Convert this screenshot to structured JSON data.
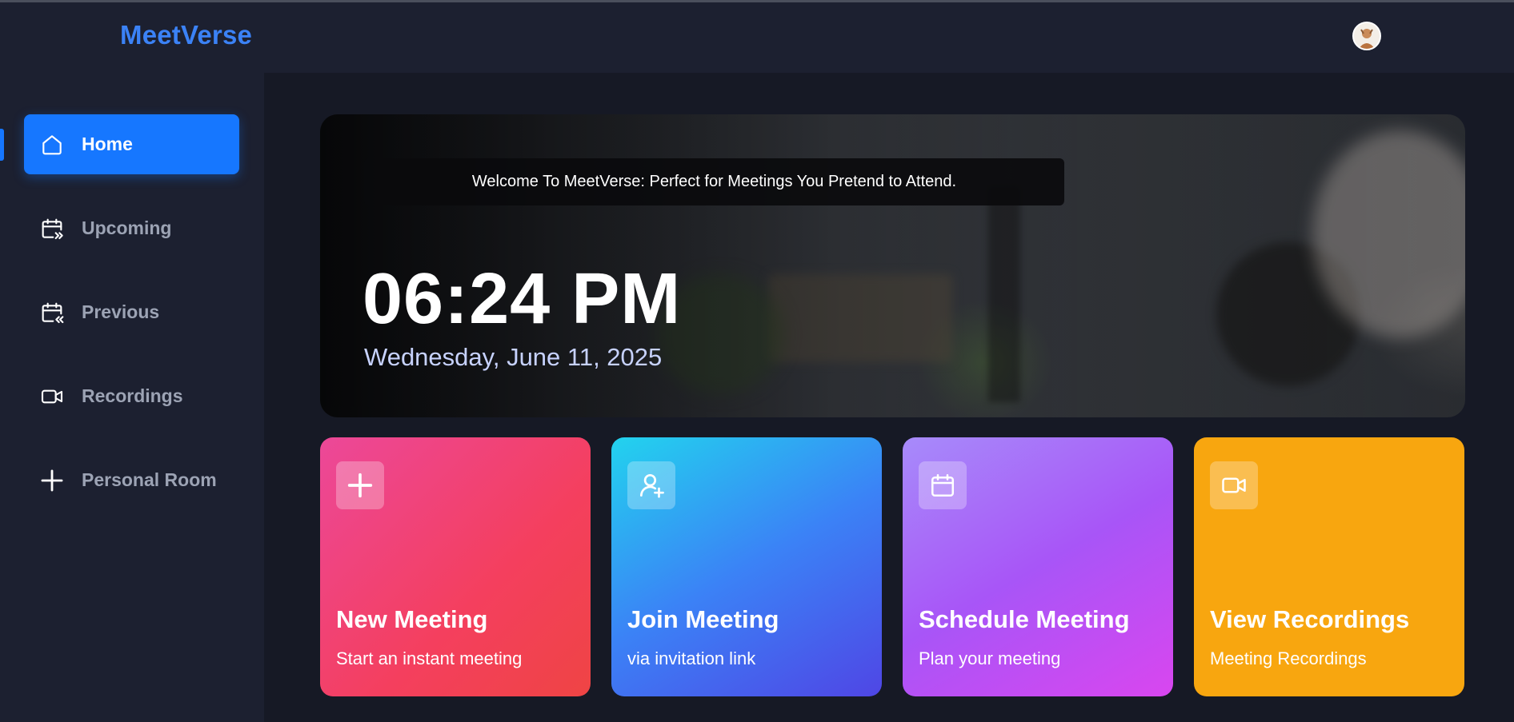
{
  "app": {
    "brand": "MeetVerse",
    "accent_color": "#3b82f6",
    "avatar_icon": "user-avatar"
  },
  "sidebar": {
    "items": [
      {
        "label": "Home",
        "icon": "home-icon",
        "active": true
      },
      {
        "label": "Upcoming",
        "icon": "calendar-forward-icon",
        "active": false
      },
      {
        "label": "Previous",
        "icon": "calendar-back-icon",
        "active": false
      },
      {
        "label": "Recordings",
        "icon": "video-icon",
        "active": false
      },
      {
        "label": "Personal Room",
        "icon": "plus-icon",
        "active": false
      }
    ]
  },
  "hero": {
    "welcome": "Welcome To MeetVerse: Perfect for Meetings You Pretend to Attend.",
    "time": "06:24 PM",
    "date": "Wednesday, June 11, 2025"
  },
  "cards": [
    {
      "title": "New Meeting",
      "subtitle": "Start an instant meeting",
      "icon": "plus-icon",
      "color": "#f43f5e"
    },
    {
      "title": "Join Meeting",
      "subtitle": "via invitation link",
      "icon": "user-plus-icon",
      "color": "#3b82f6"
    },
    {
      "title": "Schedule Meeting",
      "subtitle": "Plan your meeting",
      "icon": "calendar-icon",
      "color": "#a855f7"
    },
    {
      "title": "View Recordings",
      "subtitle": "Meeting Recordings",
      "icon": "video-icon",
      "color": "#f8a60f"
    }
  ]
}
